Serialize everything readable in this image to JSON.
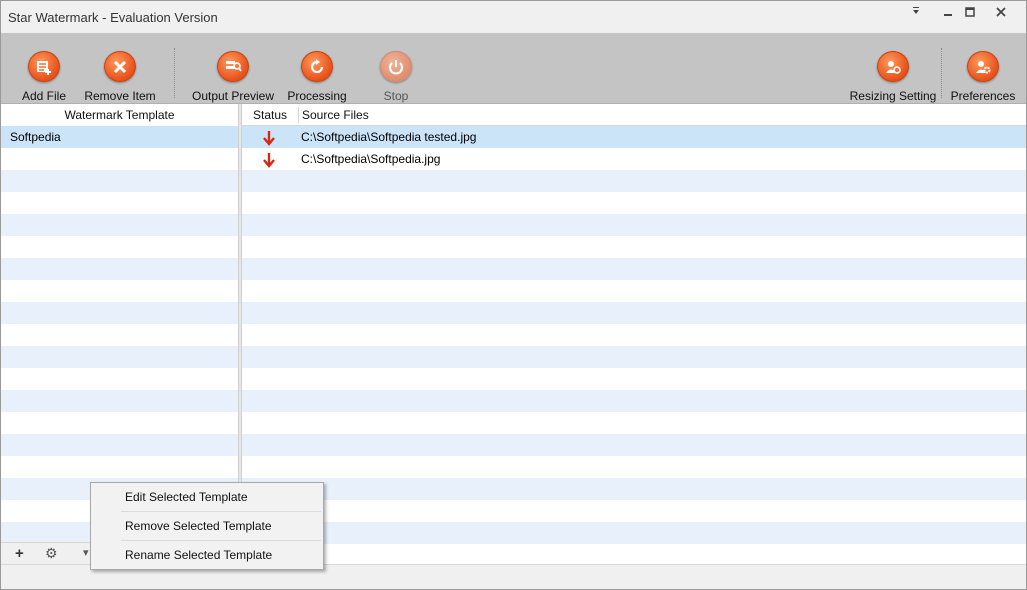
{
  "window": {
    "title": "Star Watermark - Evaluation Version",
    "controls": [
      "menu-arrow-icon",
      "minimize-icon",
      "maximize-icon",
      "close-icon"
    ]
  },
  "toolbar": {
    "add_file": "Add File",
    "remove_item": "Remove Item",
    "output_preview": "Output Preview",
    "processing": "Processing",
    "stop": "Stop",
    "resizing_setting": "Resizing Setting",
    "preferences": "Preferences"
  },
  "templates": {
    "header": "Watermark Template",
    "items": [
      "Softpedia"
    ]
  },
  "files": {
    "headers": {
      "status": "Status",
      "source": "Source Files"
    },
    "rows": [
      {
        "status_icon": "red-down-arrow-icon",
        "path": "C:\\Softpedia\\Softpedia tested.jpg"
      },
      {
        "status_icon": "red-down-arrow-icon",
        "path": "C:\\Softpedia\\Softpedia.jpg"
      }
    ]
  },
  "context_menu": {
    "items": [
      "Edit Selected Template",
      "Remove Selected Template",
      "Rename Selected Template"
    ]
  },
  "footer": {
    "add_symbol": "+",
    "gear_symbol": "⚙",
    "dropdown_symbol": "▾"
  },
  "colors": {
    "toolbar_bg": "#c4c4c4",
    "accent_orange": "#e8501a",
    "selected_row": "#cce4f7",
    "alt_row": "#e8f0fb",
    "status_arrow": "#d42a14"
  }
}
